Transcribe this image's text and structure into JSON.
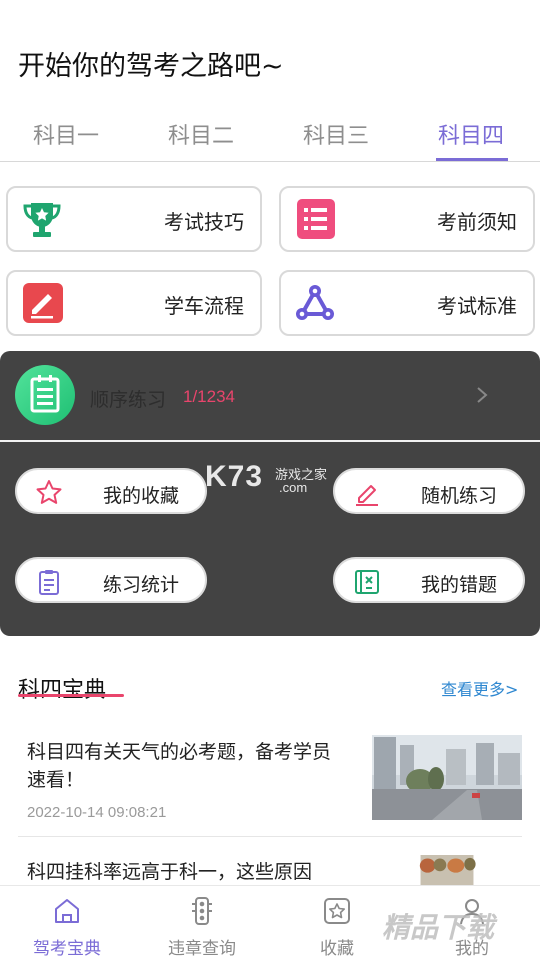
{
  "header": {
    "title": "开始你的驾考之路吧~"
  },
  "tabs": [
    {
      "label": "科目一"
    },
    {
      "label": "科目二"
    },
    {
      "label": "科目三"
    },
    {
      "label": "科目四"
    }
  ],
  "active_tab": "科目四",
  "grid": [
    {
      "label": "考试技巧",
      "icon": "trophy-icon"
    },
    {
      "label": "考前须知",
      "icon": "list-icon"
    },
    {
      "label": "学车流程",
      "icon": "pencil-square-icon"
    },
    {
      "label": "考试标准",
      "icon": "network-icon"
    }
  ],
  "practice": {
    "sequence_label": "顺序练习",
    "sequence_count": "1/1234",
    "actions": [
      {
        "label": "我的收藏",
        "icon": "star-icon"
      },
      {
        "label": "随机练习",
        "icon": "edit-pen-icon"
      },
      {
        "label": "练习统计",
        "icon": "clipboard-icon"
      },
      {
        "label": "我的错题",
        "icon": "wrong-answers-icon"
      }
    ]
  },
  "section": {
    "title": "科四宝典",
    "more": "查看更多>"
  },
  "articles": [
    {
      "title": "科目四有关天气的必考题，备考学员速看！",
      "time": "2022-10-14 09:08:21"
    },
    {
      "title": "科四挂科率远高于科一，这些原因"
    }
  ],
  "nav": [
    {
      "label": "驾考宝典",
      "icon": "home-icon"
    },
    {
      "label": "违章查询",
      "icon": "traffic-light-icon"
    },
    {
      "label": "收藏",
      "icon": "bookmark-star-icon"
    },
    {
      "label": "我的",
      "icon": "user-icon"
    }
  ],
  "watermarks": {
    "k73": "K73",
    "k73_sub1": "游戏之家",
    "k73_sub2": ".com",
    "jingpin": "精品下载"
  },
  "colors": {
    "accent": "#7b6cd6",
    "pink": "#e9456c",
    "link": "#2e87d0",
    "panel": "#434343"
  }
}
